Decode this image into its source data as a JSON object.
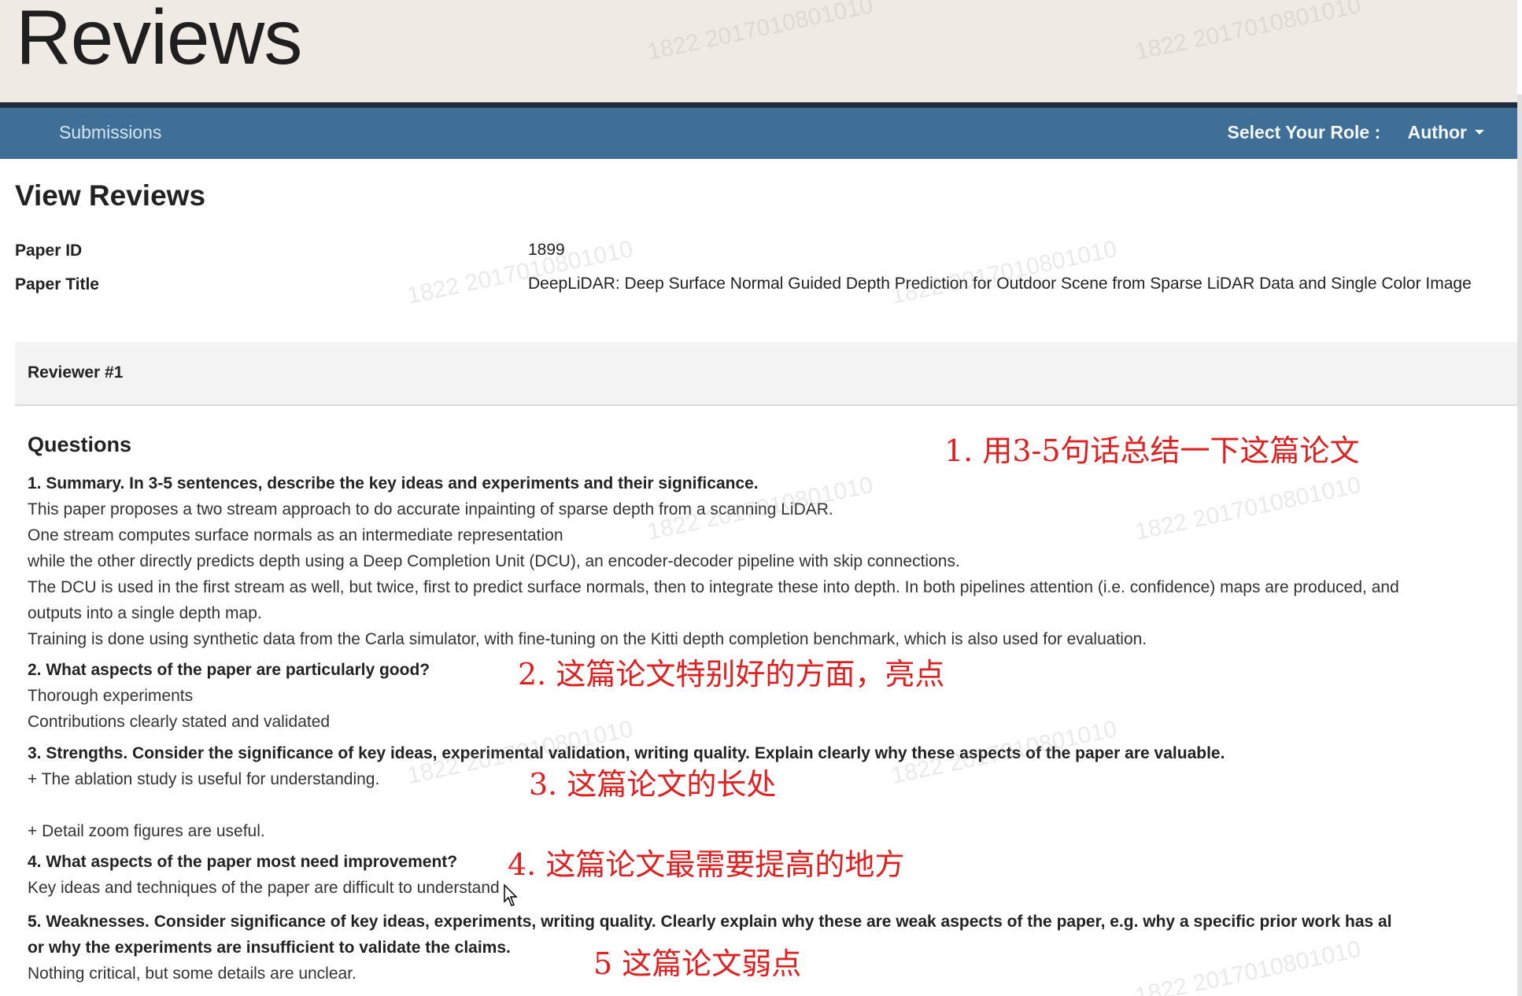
{
  "header": {
    "app_title": "Reviews"
  },
  "nav": {
    "submissions_label": "Submissions",
    "role_label": "Select Your Role :",
    "role_value": "Author",
    "role_caret_icon": "caret-down-icon"
  },
  "page": {
    "heading": "View Reviews",
    "paper_id_label": "Paper ID",
    "paper_id_value": "1899",
    "paper_title_label": "Paper Title",
    "paper_title_value": "DeepLiDAR: Deep Surface Normal Guided Depth Prediction for Outdoor Scene from Sparse LiDAR Data and Single Color Image"
  },
  "reviewer": {
    "title": "Reviewer #1",
    "questions_heading": "Questions",
    "lines": [
      "1. Summary. In 3-5 sentences, describe the key ideas and experiments and their significance.",
      "This paper proposes a two stream approach to do accurate inpainting of sparse depth from a scanning LiDAR.",
      "One stream computes surface normals as an intermediate representation",
      "while the other directly predicts depth using a Deep Completion Unit (DCU), an encoder-decoder pipeline with skip connections.",
      "The DCU is used in the first stream as well, but twice, first to predict surface normals, then to integrate these into depth. In both pipelines attention (i.e. confidence) maps are produced, and",
      "outputs into a single depth map.",
      "Training is done using synthetic data from the Carla simulator, with fine-tuning on the Kitti depth completion benchmark, which is also used for evaluation.",
      "2. What aspects of the paper are particularly good?",
      "Thorough experiments",
      "Contributions clearly stated and validated",
      "3. Strengths. Consider the significance of key ideas, experimental validation, writing quality. Explain clearly why these aspects of the paper are valuable.",
      "+ The ablation study is useful for understanding.",
      "+ Detail zoom figures are useful.",
      "4. What aspects of the paper most need improvement?",
      "Key ideas and techniques of the paper are difficult to understand",
      "5. Weaknesses. Consider significance of key ideas, experiments, writing quality. Clearly explain why these are weak aspects of the paper, e.g. why a specific prior work has al",
      "or why the experiments are insufficient to validate the claims.",
      "Nothing critical, but some details are unclear."
    ]
  },
  "annotations": [
    "1. 用3-5句话总结一下这篇论文",
    "2. 这篇论文特别好的方面，亮点",
    "3. 这篇论文的长处",
    "4. 这篇论文最需要提高的地方",
    "5 这篇论文弱点"
  ],
  "watermark_text": "1822 2017010801010",
  "colors": {
    "header_bg": "#efebe4",
    "navbar_bg": "#3f6f97",
    "annotation_red": "#e02020"
  }
}
